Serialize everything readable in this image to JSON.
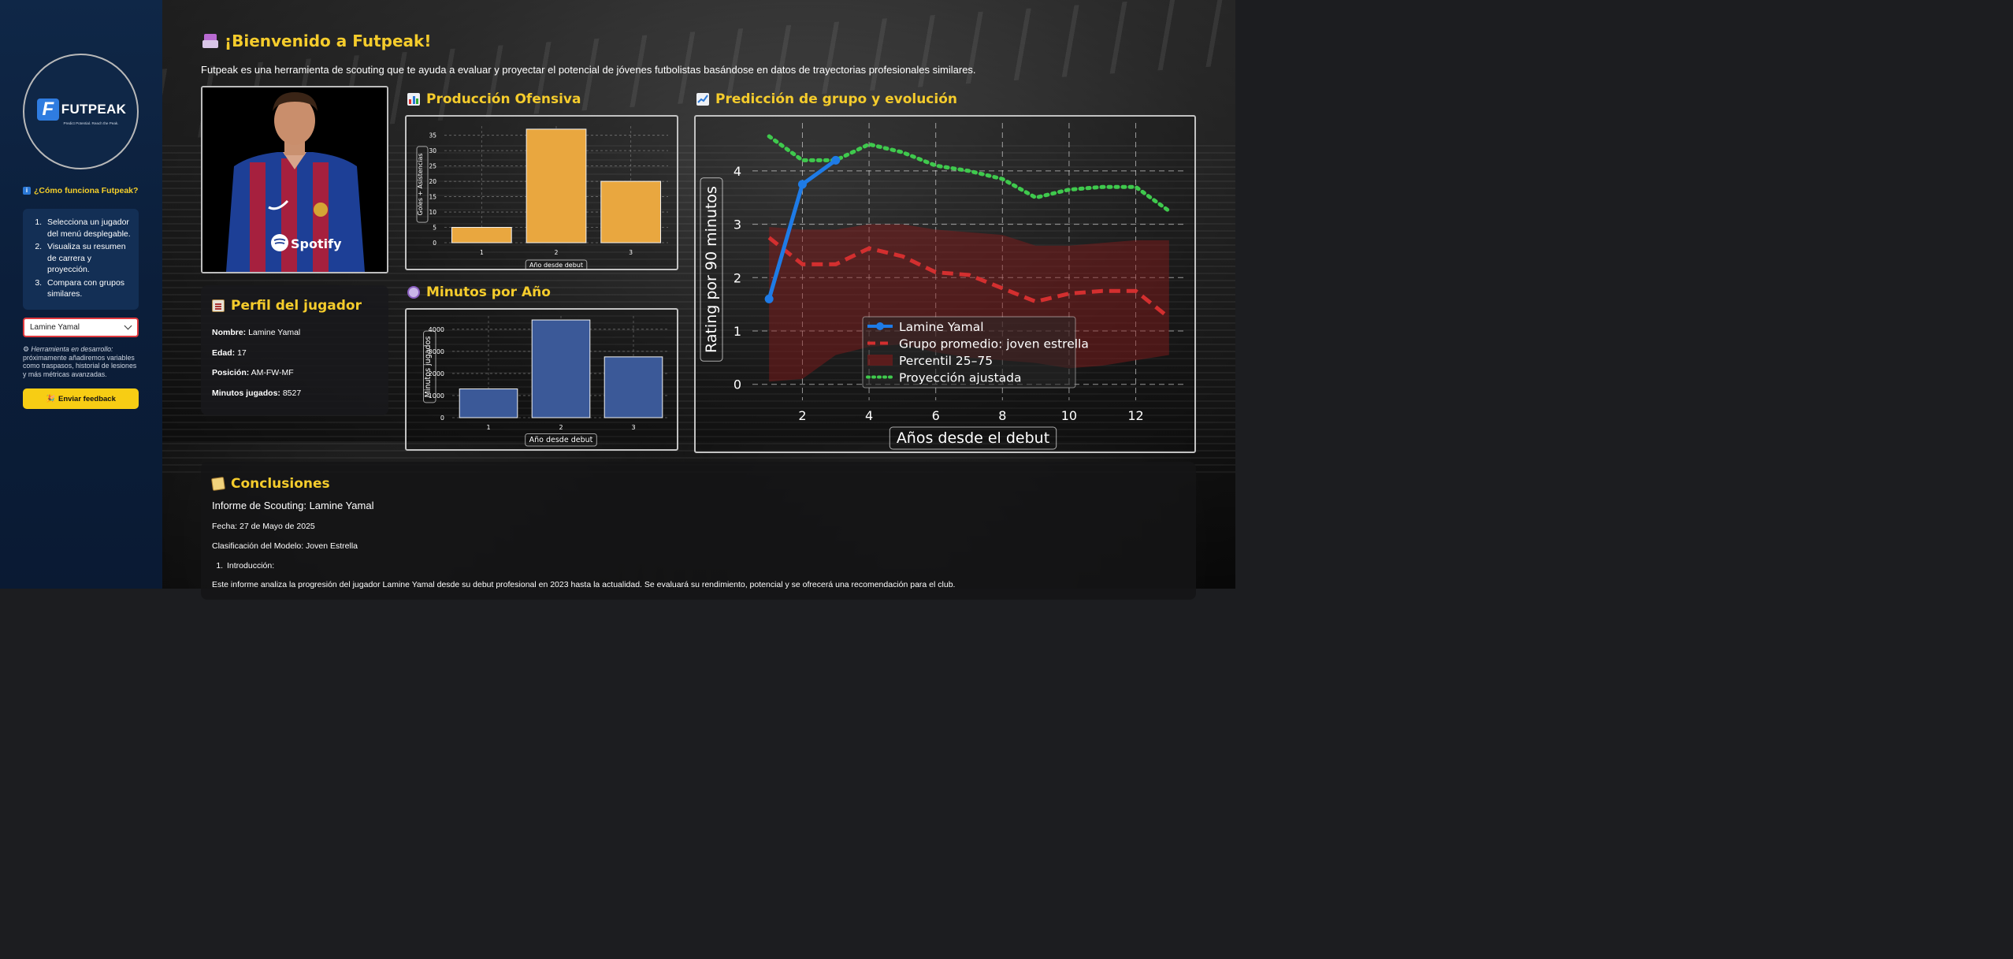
{
  "sidebar": {
    "logo": {
      "letter": "F",
      "name": "FUTPEAK",
      "tagline": "Predict Potential. Reach the Peak."
    },
    "how_title": "¿Cómo funciona Futpeak?",
    "steps": [
      "Selecciona un jugador del menú desplegable.",
      "Visualiza su resumen de carrera y proyección.",
      "Compara con grupos similares."
    ],
    "player_select": {
      "value": "Lamine Yamal"
    },
    "dev_note": {
      "label": "Herramienta en desarrollo:",
      "text": "próximamente añadiremos variables como traspasos, historial de lesiones y más métricas avanzadas."
    },
    "feedback_button": "Enviar feedback"
  },
  "header": {
    "title": "¡Bienvenido a Futpeak!",
    "subtitle": "Futpeak es una herramienta de scouting que te ayuda a evaluar y proyectar el potencial de jóvenes futbolistas basándose en datos de trayectorias profesionales similares."
  },
  "profile": {
    "title": "Perfil del jugador",
    "rows": [
      {
        "label": "Nombre:",
        "value": "Lamine Yamal"
      },
      {
        "label": "Edad:",
        "value": "17"
      },
      {
        "label": "Posición:",
        "value": "AM-FW-MF"
      },
      {
        "label": "Minutos jugados:",
        "value": "8527"
      }
    ]
  },
  "photo": {
    "sponsor": "Spotify"
  },
  "sections": {
    "offense": "Producción Ofensiva",
    "minutes": "Minutos por Año",
    "prediction": "Predicción de grupo y evolución",
    "conclusions": "Conclusiones"
  },
  "colors": {
    "accent": "#f5cc2c",
    "offense_bar": "#e9a73f",
    "minutes_bar": "#3b5998",
    "player_line": "#1e7be6",
    "group_line": "#d32f2f",
    "projection_line": "#3fc94d",
    "band": "#8b1a1a"
  },
  "chart_data": [
    {
      "type": "bar",
      "title": "Producción Ofensiva",
      "categories": [
        "1",
        "2",
        "3"
      ],
      "values": [
        5,
        37,
        20
      ],
      "xlabel": "Año desde debut",
      "ylabel": "Goles + Asistencias",
      "ylim": [
        0,
        38
      ],
      "yticks": [
        0,
        5,
        10,
        15,
        20,
        25,
        30,
        35
      ],
      "grid": true
    },
    {
      "type": "bar",
      "title": "Minutos por Año",
      "categories": [
        "1",
        "2",
        "3"
      ],
      "values": [
        1300,
        4420,
        2750
      ],
      "xlabel": "Año desde debut",
      "ylabel": "Minutos jugados",
      "ylim": [
        0,
        4600
      ],
      "yticks": [
        0,
        1000,
        2000,
        3000,
        4000
      ],
      "grid": true
    },
    {
      "type": "line",
      "title": "Predicción de grupo y evolución",
      "xlabel": "Años desde el debut",
      "ylabel": "Rating por 90 minutos",
      "xlim": [
        0.5,
        13.5
      ],
      "ylim": [
        -0.3,
        4.9
      ],
      "xticks": [
        2,
        4,
        6,
        8,
        10,
        12
      ],
      "yticks": [
        0,
        1,
        2,
        3,
        4
      ],
      "grid": true,
      "legend_position": "lower-center",
      "series": [
        {
          "name": "Lamine Yamal",
          "style": "solid-markers",
          "x": [
            1,
            2,
            3
          ],
          "y": [
            1.6,
            3.75,
            4.2
          ]
        },
        {
          "name": "Grupo promedio: joven estrella",
          "style": "dashed",
          "x": [
            1,
            2,
            3,
            4,
            5,
            6,
            7,
            8,
            9,
            10,
            11,
            12,
            13
          ],
          "y": [
            2.75,
            2.25,
            2.25,
            2.55,
            2.4,
            2.1,
            2.05,
            1.8,
            1.55,
            1.7,
            1.75,
            1.75,
            1.25
          ]
        },
        {
          "name": "Percentil 25–75",
          "style": "band",
          "x": [
            1,
            2,
            3,
            4,
            5,
            6,
            7,
            8,
            9,
            10,
            11,
            12,
            13
          ],
          "low": [
            0.05,
            0.1,
            0.55,
            0.7,
            0.75,
            0.6,
            0.5,
            0.45,
            0.4,
            0.3,
            0.35,
            0.45,
            0.55
          ],
          "high": [
            2.95,
            2.9,
            2.9,
            3.0,
            3.0,
            2.9,
            2.85,
            2.8,
            2.6,
            2.6,
            2.65,
            2.7,
            2.7
          ]
        },
        {
          "name": "Proyección ajustada",
          "style": "dotted",
          "x": [
            1,
            2,
            3,
            4,
            5,
            6,
            7,
            8,
            9,
            10,
            11,
            12,
            13
          ],
          "y": [
            4.65,
            4.2,
            4.2,
            4.5,
            4.35,
            4.1,
            4.0,
            3.85,
            3.5,
            3.65,
            3.7,
            3.7,
            3.25
          ]
        }
      ]
    }
  ],
  "conclusions": {
    "heading": "Informe de Scouting: Lamine Yamal",
    "date": "Fecha: 27 de Mayo de 2025",
    "classification": "Clasificación del Modelo: Joven Estrella",
    "list": [
      "Introducción:"
    ],
    "partial": "Este informe analiza la progresión del jugador Lamine Yamal desde su debut profesional en 2023 hasta la actualidad. Se evaluará su rendimiento, potencial y se ofrecerá una recomendación para el club."
  }
}
